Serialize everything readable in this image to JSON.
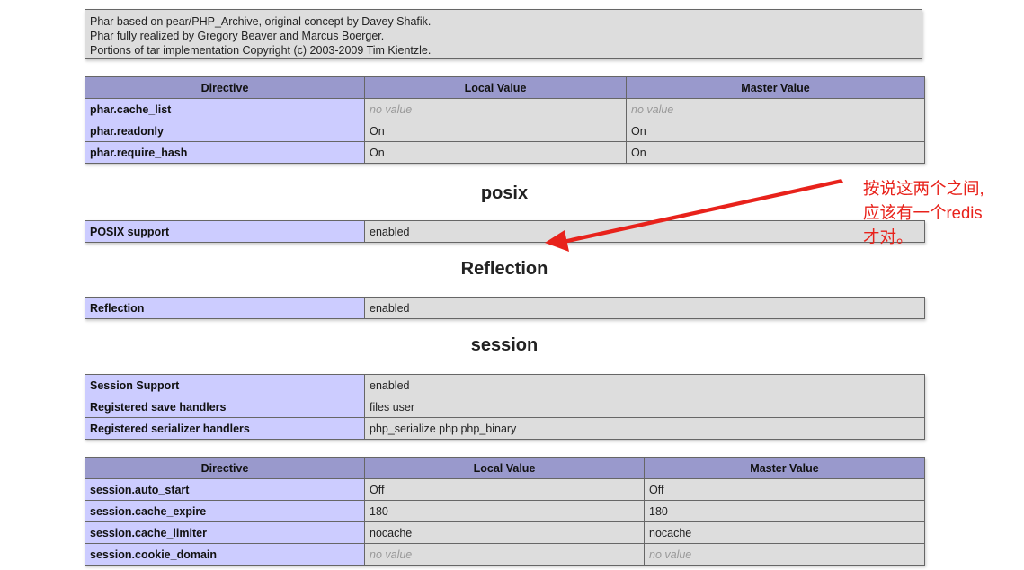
{
  "credits": {
    "lines": [
      "Phar based on pear/PHP_Archive, original concept by Davey Shafik.",
      "Phar fully realized by Gregory Beaver and Marcus Boerger.",
      "Portions of tar implementation Copyright (c) 2003-2009 Tim Kientzle."
    ]
  },
  "phar_directives": {
    "headers": [
      "Directive",
      "Local Value",
      "Master Value"
    ],
    "rows": [
      {
        "directive": "phar.cache_list",
        "local": "no value",
        "master": "no value"
      },
      {
        "directive": "phar.readonly",
        "local": "On",
        "master": "On"
      },
      {
        "directive": "phar.require_hash",
        "local": "On",
        "master": "On"
      }
    ]
  },
  "posix": {
    "title": "posix",
    "rows": [
      {
        "label": "POSIX support",
        "value": "enabled"
      }
    ]
  },
  "reflection": {
    "title": "Reflection",
    "rows": [
      {
        "label": "Reflection",
        "value": "enabled"
      }
    ]
  },
  "session": {
    "title": "session",
    "info_rows": [
      {
        "label": "Session Support",
        "value": "enabled"
      },
      {
        "label": "Registered save handlers",
        "value": "files user"
      },
      {
        "label": "Registered serializer handlers",
        "value": "php_serialize php php_binary"
      }
    ],
    "headers": [
      "Directive",
      "Local Value",
      "Master Value"
    ],
    "rows": [
      {
        "directive": "session.auto_start",
        "local": "Off",
        "master": "Off"
      },
      {
        "directive": "session.cache_expire",
        "local": "180",
        "master": "180"
      },
      {
        "directive": "session.cache_limiter",
        "local": "nocache",
        "master": "nocache"
      },
      {
        "directive": "session.cookie_domain",
        "local": "no value",
        "master": "no value"
      }
    ]
  },
  "annotation": {
    "lines": [
      "按说这两个之间,",
      "应该有一个redis",
      "才对。"
    ],
    "color": "#e8221b"
  },
  "colors": {
    "header_bg": "#9999cc",
    "label_bg": "#ccccff",
    "value_bg": "#dddddd",
    "no_value_text": "#999999"
  }
}
